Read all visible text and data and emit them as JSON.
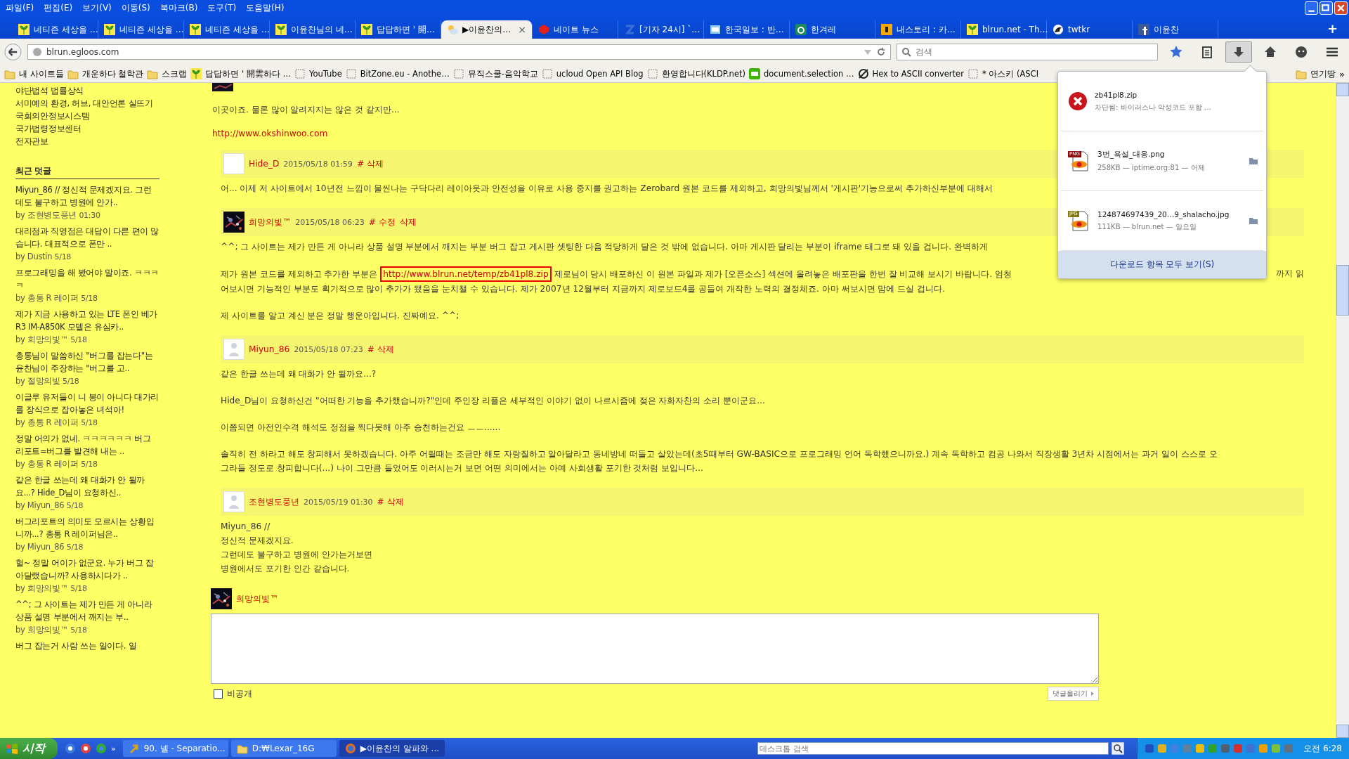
{
  "menu": [
    "파일(F)",
    "편집(E)",
    "보기(V)",
    "이동(S)",
    "북마크(B)",
    "도구(T)",
    "도움말(H)"
  ],
  "tabs": [
    {
      "label": "네티즌 세상을 …",
      "selected": false
    },
    {
      "label": "네티즌 세상을 …",
      "selected": false
    },
    {
      "label": "네티즌 세상을 …",
      "selected": false
    },
    {
      "label": "이윤찬님의 네…",
      "selected": false
    },
    {
      "label": "답답하면 ' 開…",
      "selected": false
    },
    {
      "label": "▶이윤찬의…",
      "selected": true
    },
    {
      "label": "네이트 뉴스",
      "selected": false
    },
    {
      "label": "[기자 24시] `…",
      "selected": false
    },
    {
      "label": "한국일보 : 반…",
      "selected": false
    },
    {
      "label": "한겨레",
      "selected": false
    },
    {
      "label": "내스토리 : 카…",
      "selected": false
    },
    {
      "label": "blrun.net - Th…",
      "selected": false
    },
    {
      "label": "twtkr",
      "selected": false
    },
    {
      "label": "이윤찬",
      "selected": false
    }
  ],
  "tab_close": "×",
  "new_tab": "+",
  "address": {
    "value": "blrun.egloos.com"
  },
  "search": {
    "placeholder": "검색"
  },
  "bookmarks": [
    "내 사이트들",
    "개운하다 철학관",
    "스크랩",
    "답답하면 ' 開雲하다 …",
    "YouTube",
    "BitZone.eu - Anothe…",
    "뮤직스쿨-음악학교",
    "ucloud Open API Blog",
    "환영합니다(KLDP.net)",
    "document.selection …",
    "Hex to ASCII converter",
    "* 아스키 (ASCI"
  ],
  "bookmarks_right": {
    "label": "연기땅",
    "more": "»"
  },
  "sidebar": {
    "links": [
      "야단법석 법률상식",
      "서미예의 환경, 허브, 대안언론 실뜨기",
      "국회의안정보시스템",
      "국가법령정보센터",
      "전자관보"
    ],
    "recent_title": "최근 덧글",
    "recent": [
      {
        "text": "Miyun_86 // 정신적 문제겠지요. 그런데도 불구하고 병원에 안가..",
        "by": "by 조현병도풍년",
        "date": "01:30"
      },
      {
        "text": "대리점과 직영점은 대답이 다른 편이 많습니다. 대표적으로 폰만 ..",
        "by": "by Dustin",
        "date": "5/18"
      },
      {
        "text": "프로그래밍을 해 봤어야 말이죠. ㅋㅋㅋㅋ",
        "by": "by 총통 R 레이퍼",
        "date": "5/18"
      },
      {
        "text": "제가 지금 사용하고 있는 LTE 폰인 베가R3 IM-A850K 모델은 유심카..",
        "by": "by 희망의빛™",
        "date": "5/18"
      },
      {
        "text": "총통님이 말씀하신 \"버그를 잡는다\"는 윤찬님이 주장하는 \"버그를 고..",
        "by": "by 절망의빛",
        "date": "5/18"
      },
      {
        "text": "이글루 유저들이 니 봉이 아니다 대가리를 장식으로 잡아놓은 녀석아!",
        "by": "by 총통 R 레이퍼",
        "date": "5/18"
      },
      {
        "text": "정말 어의가 없네. ㅋㅋㅋㅋㅋㅋ 버그 리포트=버그를 발견해 내는 ..",
        "by": "by 총통 R 레이퍼",
        "date": "5/18"
      },
      {
        "text": "같은 한글 쓰는데 왜 대화가 안 될까요...? Hide_D님이 요청하신..",
        "by": "by Miyun_86",
        "date": "5/18"
      },
      {
        "text": "버그리포트의 의미도 모르시는 상황입니까...? 총통 R 레이퍼님은..",
        "by": "by Miyun_86",
        "date": "5/18"
      },
      {
        "text": "헐~ 정말 어이가 없군요. 누가 버그 잡아달랬습니까? 사용하시다가 ..",
        "by": "by 희망의빛™",
        "date": "5/18"
      },
      {
        "text": "^^; 그 사이트는 제가 만든 게 아니라 상품 설명 부분에서 깨지는 부..",
        "by": "by 희망의빛™",
        "date": "5/18"
      },
      {
        "text": "버그 잡는거 사람 쓰는 일이다. 일"
      }
    ]
  },
  "post_tail": {
    "text": "이곳이죠. 물론 많이 알려지지는 않은 것 같지만...",
    "link": "http://www.okshinwoo.com"
  },
  "comments": [
    {
      "author": "Hide_D",
      "date": "2015/05/18 01:59",
      "actions": [
        "# 삭제"
      ],
      "paragraphs": [
        [
          {
            "parts": [
              {
                "text": "어... 이제 저 사이트에서 10년전 느낌이 물씬나는 구닥다리 레이아웃과 안전성을 이유로 사용 중지를 권고하는 Zerobard 원본 코드를 제외하고, 희망의빛님께서 '게시판'기능으로써 추가하신부분에 대해서"
              }
            ]
          }
        ]
      ]
    },
    {
      "author": "희망의빛™",
      "date": "2015/05/18 06:23",
      "actions": [
        "# 수정",
        "삭제"
      ],
      "paragraphs": [
        [
          {
            "parts": [
              {
                "text": "^^; 그 사이트는 제가 만든 게 아니라 상품 설명 부분에서 깨지는 부분 버그 잡고 게시판 셋팅한 다음 적당하게 달은 것 밖에 없습니다. 아마 게시판 달리는 부분이 iframe 태그로 돼 있을 겁니다. 완벽하게"
              }
            ]
          }
        ],
        [
          {
            "parts": [
              {
                "text": "제가 원본 코드를 제외하고 추가한 부분은 "
              },
              {
                "link": "http://www.blrun.net/temp/zb41pl8.zip",
                "highlighted": true
              },
              {
                "text": " 제로님이 당시 배포하신 이 원본 파일과 제가 [오픈소스] 섹션에 올려놓은 배포판을 한번 잘 비교해 보시기 바랍니다. 엄청"
              }
            ],
            "tail": "까지 읽"
          },
          {
            "parts": [
              {
                "text": "어보시면 기능적인 부분도 획기적으로 많이 추가가 됐음을 눈치챌 수 있습니다. 제가 2007년 12월부터 지금까지 제로보드4를 공들여 개작한 노력의 결정체죠. 아마 써보시면 맘에 드실 겁니다."
              }
            ]
          }
        ],
        [
          {
            "parts": [
              {
                "text": "제 사이트를 알고 계신 분은 정말 행운아입니다. 진짜예요. ^^;"
              }
            ]
          }
        ]
      ]
    },
    {
      "author": "Miyun_86",
      "date": "2015/05/18 07:23",
      "actions": [
        "# 삭제"
      ],
      "paragraphs": [
        [
          {
            "parts": [
              {
                "text": "같은 한글 쓰는데 왜 대화가 안 될까요...?"
              }
            ]
          }
        ],
        [
          {
            "parts": [
              {
                "text": "Hide_D님이 요청하신건 \"어떠한 기능을 추가했습니까?\"인데 주인장 리플은 세부적인 이야기 없이 나르시즘에 젖은 자화자찬의 소리 뿐이군요..."
              }
            ]
          }
        ],
        [
          {
            "parts": [
              {
                "text": "이쯤되면 아전인수격 해석도 정점을 찍다못해 아주 승천하는건요 ㅡㅡ......"
              }
            ]
          }
        ],
        [
          {
            "parts": [
              {
                "text": "솔직히 전 하라고 해도 창피해서 못하겠습니다. 아주 어릴때는 조금만 해도 자랑질하고 알아달라고 동네방네 떠들고 살았는데(초5때부터 GW-BASIC으로 프로그래밍 언어 독학했으니까요.) 계속 독학하고 컴공 나와서 직장생활 3년차 시점에서는 과거 일이 스스로 오"
              }
            ]
          },
          {
            "parts": [
              {
                "text": "그라들 정도로 창피합니다(...) 나이 그만큼 들었어도 이러시는거 보면 어떤 의미에서는 아예 사회생활 포기한 것처럼 보입니다..."
              }
            ]
          }
        ]
      ]
    },
    {
      "author": "조현병도풍년",
      "date": "2015/05/19 01:30",
      "actions": [
        "# 삭제"
      ],
      "paragraphs": [
        [
          {
            "parts": [
              {
                "text": "Miyun_86 //"
              }
            ]
          },
          {
            "parts": [
              {
                "text": "정신적 문제겠지요."
              }
            ]
          },
          {
            "parts": [
              {
                "text": "그런데도 불구하고 병원에 안가는거보면"
              }
            ]
          },
          {
            "parts": [
              {
                "text": "병원에서도 포기한 인간 같습니다."
              }
            ]
          }
        ]
      ]
    }
  ],
  "reply_form": {
    "author": "희망의빛™",
    "private_label": "비공개",
    "private_checked": false,
    "submit": "댓글올리기"
  },
  "downloads": {
    "items": [
      {
        "kind": "blocked",
        "name": "zb41pl8.zip",
        "detail": "차단됨: 바이러스나 악성코드 포함 …"
      },
      {
        "kind": "file",
        "type_label": "PNG",
        "name": "3번_욕설_대응.png",
        "detail": "258KB — iptime.org:81 — 어제"
      },
      {
        "kind": "file",
        "type_label": "JPG",
        "name": "124874697439_20…9_shalacho.jpg",
        "detail": "111KB — blrun.net — 일요일"
      }
    ],
    "show_all": "다운로드 항목 모두 보기(S)"
  },
  "taskbar": {
    "start": "시작",
    "more": "»",
    "tasks": [
      {
        "label": "90. 넬 - Separatio...",
        "selected": false
      },
      {
        "label": "D:₩Lexar_16G",
        "selected": false
      },
      {
        "label": "▶이윤찬의 알파와 ...",
        "selected": true
      }
    ],
    "search": {
      "placeholder": "데스크톱 검색"
    },
    "clock": "오전 6:28"
  }
}
